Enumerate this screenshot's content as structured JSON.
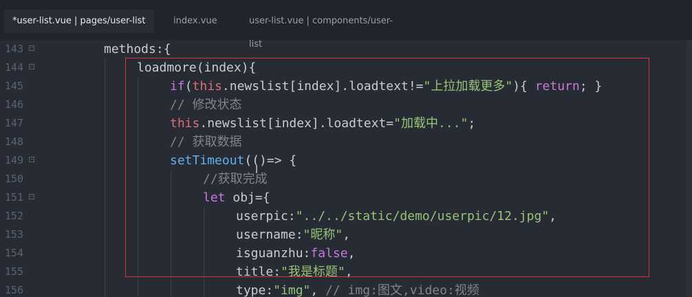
{
  "tabs": [
    {
      "label": "*user-list.vue | pages/user-list",
      "active": true
    },
    {
      "label": "index.vue",
      "active": false
    },
    {
      "label": "user-list.vue | components/user-list",
      "active": false
    }
  ],
  "lines": [
    {
      "num": "143",
      "fold": true
    },
    {
      "num": "144",
      "fold": true
    },
    {
      "num": "145",
      "fold": false
    },
    {
      "num": "146",
      "fold": false
    },
    {
      "num": "147",
      "fold": false
    },
    {
      "num": "148",
      "fold": false
    },
    {
      "num": "149",
      "fold": true
    },
    {
      "num": "150",
      "fold": false
    },
    {
      "num": "151",
      "fold": true
    },
    {
      "num": "152",
      "fold": false
    },
    {
      "num": "153",
      "fold": false
    },
    {
      "num": "154",
      "fold": false
    },
    {
      "num": "155",
      "fold": false
    },
    {
      "num": "156",
      "fold": false
    }
  ],
  "code": {
    "l143": {
      "a": "methods",
      "b": ":{"
    },
    "l144": {
      "a": "loadmore",
      "b": "(index){"
    },
    "l145": {
      "a": "if",
      "b": "(",
      "c": "this",
      "d": ".newslist[index].loadtext!=",
      "e": "\"上拉加载更多\"",
      "f": "){ ",
      "g": "return",
      "h": "; }"
    },
    "l146": {
      "a": "// 修改状态"
    },
    "l147": {
      "a": "this",
      "b": ".newslist[index].loadtext=",
      "c": "\"加载中...\"",
      "d": ";"
    },
    "l148": {
      "a": "// 获取数据"
    },
    "l149": {
      "a": "setTimeout",
      "b": "(()=> {"
    },
    "l150": {
      "a": "//获取完成"
    },
    "l151": {
      "a": "let",
      "b": " obj={"
    },
    "l152": {
      "a": "userpic",
      "b": ":",
      "c": "\"../../static/demo/userpic/12.jpg\"",
      "d": ","
    },
    "l153": {
      "a": "username",
      "b": ":",
      "c": "\"昵称\"",
      "d": ","
    },
    "l154": {
      "a": "isguanzhu",
      "b": ":",
      "c": "false",
      "d": ","
    },
    "l155": {
      "a": "title",
      "b": ":",
      "c": "\"我是标题\"",
      "d": ","
    },
    "l156": {
      "a": "type",
      "b": ":",
      "c": "\"img\"",
      "d": ", ",
      "e": "// img:图文,video:视频"
    }
  }
}
